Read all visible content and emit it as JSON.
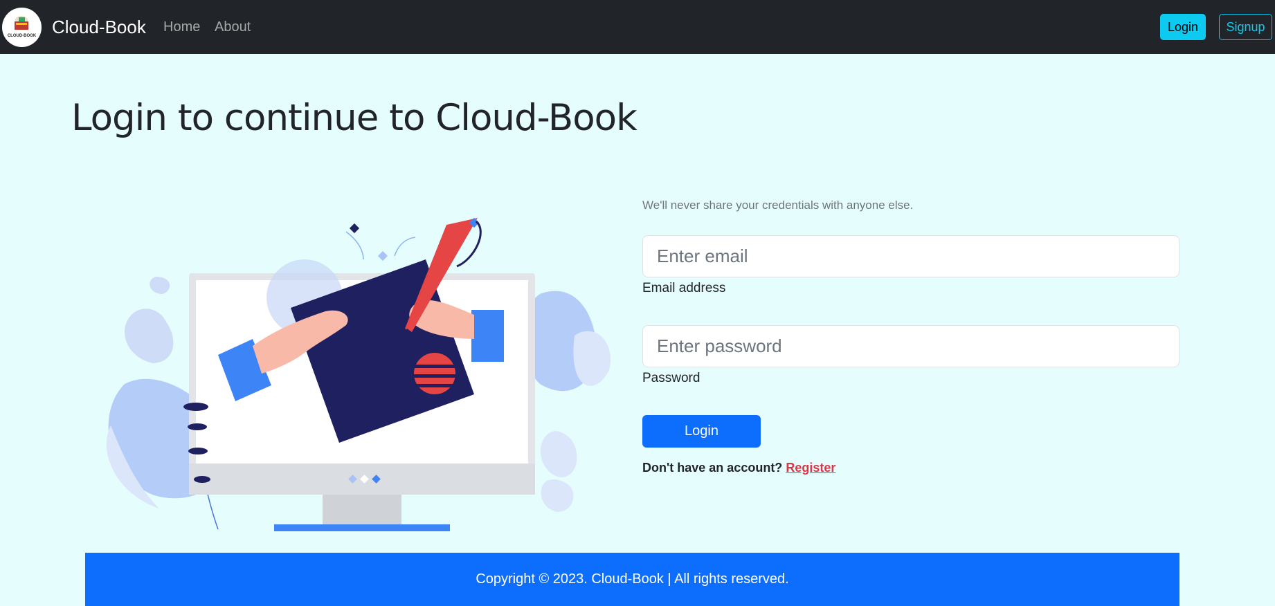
{
  "navbar": {
    "brand": "Cloud-Book",
    "logo_text": "CLOUD-BOOK",
    "links": [
      "Home",
      "About"
    ],
    "login_label": "Login",
    "signup_label": "Signup"
  },
  "page": {
    "title": "Login to continue to Cloud-Book"
  },
  "form": {
    "help_text": "We'll never share your credentials with anyone else.",
    "email_placeholder": "Enter email",
    "email_label": "Email address",
    "password_placeholder": "Enter password",
    "password_label": "Password",
    "submit_label": "Login",
    "register_prompt": "Don't have an account?",
    "register_link": "Register"
  },
  "footer": {
    "copyright": "Copyright © 2023. Cloud-Book | All rights reserved."
  },
  "colors": {
    "navbar_bg": "#212529",
    "page_bg": "#e6fdfd",
    "primary": "#0d6efd",
    "info": "#0dcaf0",
    "danger": "#dc3545"
  }
}
